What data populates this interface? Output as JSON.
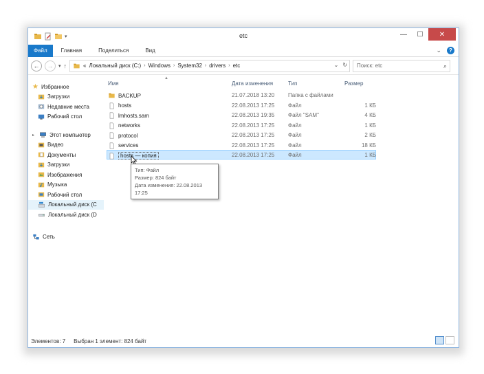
{
  "window": {
    "title": "etc",
    "minimize_glyph": "—",
    "maximize_glyph": "☐",
    "close_glyph": "✕"
  },
  "ribbon": {
    "tabs": [
      "Файл",
      "Главная",
      "Поделиться",
      "Вид"
    ],
    "expand_glyph": "⌄",
    "help_glyph": "?"
  },
  "address": {
    "prefix": "«",
    "crumbs": [
      "Локальный диск (C:)",
      "Windows",
      "System32",
      "drivers",
      "etc"
    ],
    "separator": "›",
    "dropdown_glyph": "⌄",
    "refresh_glyph": "↻"
  },
  "search": {
    "placeholder": "Поиск: etc",
    "icon_glyph": "⌕"
  },
  "nav_pane": {
    "favorites": {
      "label": "Избранное",
      "items": [
        "Загрузки",
        "Недавние места",
        "Рабочий стол"
      ]
    },
    "computer": {
      "label": "Этот компьютер",
      "items": [
        "Видео",
        "Документы",
        "Загрузки",
        "Изображения",
        "Музыка",
        "Рабочий стол",
        "Локальный диск (C",
        "Локальный диск (D"
      ]
    },
    "network": {
      "label": "Сеть"
    }
  },
  "columns": {
    "name": "Имя",
    "date": "Дата изменения",
    "type": "Тип",
    "size": "Размер"
  },
  "files": [
    {
      "name": "BACKUP",
      "date": "21.07.2018 13:20",
      "type": "Папка с файлами",
      "size": "",
      "kind": "folder"
    },
    {
      "name": "hosts",
      "date": "22.08.2013 17:25",
      "type": "Файл",
      "size": "1 КБ",
      "kind": "file"
    },
    {
      "name": "lmhosts.sam",
      "date": "22.08.2013 19:35",
      "type": "Файл \"SAM\"",
      "size": "4 КБ",
      "kind": "file"
    },
    {
      "name": "networks",
      "date": "22.08.2013 17:25",
      "type": "Файл",
      "size": "1 КБ",
      "kind": "file"
    },
    {
      "name": "protocol",
      "date": "22.08.2013 17:25",
      "type": "Файл",
      "size": "2 КБ",
      "kind": "file"
    },
    {
      "name": "services",
      "date": "22.08.2013 17:25",
      "type": "Файл",
      "size": "18 КБ",
      "kind": "file"
    },
    {
      "name": "hosts — копия",
      "date": "22.08.2013 17:25",
      "type": "Файл",
      "size": "1 КБ",
      "kind": "file",
      "selected": true
    }
  ],
  "tooltip": {
    "type_line": "Тип: Файл",
    "size_line": "Размер: 824 байт",
    "date_line": "Дата изменения: 22.08.2013 17:25"
  },
  "status": {
    "count": "Элементов: 7",
    "selected": "Выбран 1 элемент: 824 байт"
  },
  "colors": {
    "accent": "#1979ca",
    "close": "#c74a4a",
    "selection": "#cce8ff",
    "folder": "#e8b84a"
  }
}
